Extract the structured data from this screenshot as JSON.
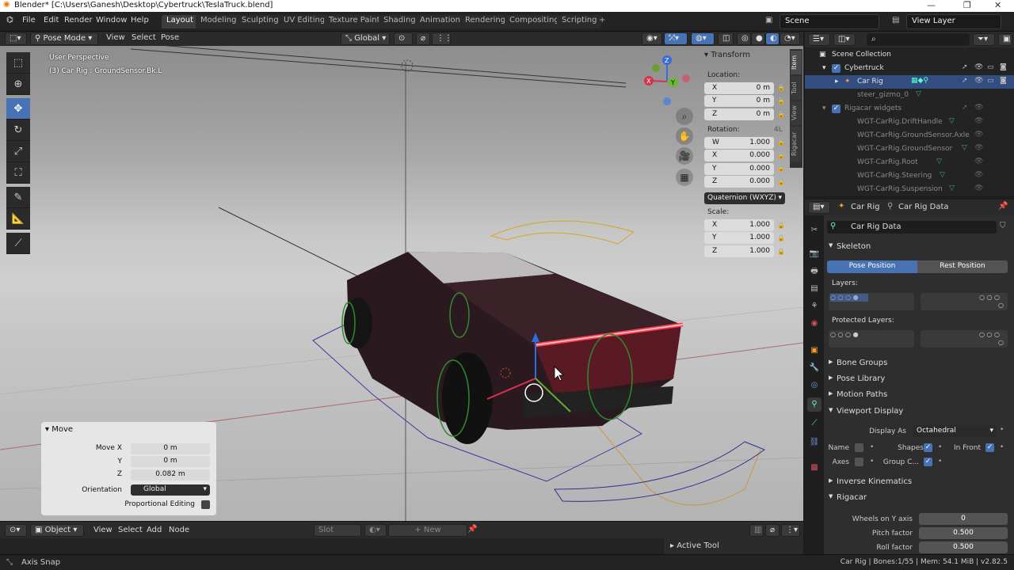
{
  "window": {
    "title": "Blender* [C:\\Users\\Ganesh\\Desktop\\Cybertruck\\TeslaTruck.blend]"
  },
  "menus": [
    "File",
    "Edit",
    "Render",
    "Window",
    "Help"
  ],
  "workspaces": [
    "Layout",
    "Modeling",
    "Sculpting",
    "UV Editing",
    "Texture Paint",
    "Shading",
    "Animation",
    "Rendering",
    "Compositing",
    "Scripting"
  ],
  "scene": {
    "label": "Scene"
  },
  "viewlayer": {
    "label": "View Layer"
  },
  "viewport": {
    "mode": "Pose Mode",
    "menus": [
      "View",
      "Select",
      "Pose"
    ],
    "orientation": "Global",
    "info_line1": "User Perspective",
    "info_line2": "(3) Car Rig : GroundSensor.Bk.L",
    "gizmo": {
      "z": "Z",
      "x": "X",
      "y": "Y"
    }
  },
  "transform": {
    "title": "Transform",
    "location_label": "Location:",
    "location": [
      {
        "k": "X",
        "v": "0 m"
      },
      {
        "k": "Y",
        "v": "0 m"
      },
      {
        "k": "Z",
        "v": "0 m"
      }
    ],
    "rotation_label": "Rotation:",
    "rotation_mode_short": "4L",
    "rotation": [
      {
        "k": "W",
        "v": "1.000"
      },
      {
        "k": "X",
        "v": "0.000"
      },
      {
        "k": "Y",
        "v": "0.000"
      },
      {
        "k": "Z",
        "v": "0.000"
      }
    ],
    "rotation_mode": "Quaternion (WXYZ)",
    "scale_label": "Scale:",
    "scale": [
      {
        "k": "X",
        "v": "1.000"
      },
      {
        "k": "Y",
        "v": "1.000"
      },
      {
        "k": "Z",
        "v": "1.000"
      }
    ]
  },
  "sidetabs": [
    "Item",
    "Tool",
    "View",
    "Rigacar"
  ],
  "move_panel": {
    "title": "Move",
    "move_x_label": "Move X",
    "move_x": "0 m",
    "y_label": "Y",
    "y": "0 m",
    "z_label": "Z",
    "z": "0.082 m",
    "orientation_label": "Orientation",
    "orientation": "Global",
    "proportional_label": "Proportional Editing"
  },
  "bottom_header": {
    "mode": "Object",
    "menus": [
      "View",
      "Select",
      "Add",
      "Node"
    ],
    "slot": "Slot",
    "new": "New"
  },
  "timeline": {
    "active_tool": "Active Tool"
  },
  "status": {
    "left": "Axis Snap",
    "right": "Car Rig | Bones:1/55 | Mem: 54.1 MiB | v2.82.5"
  },
  "outliner": {
    "rows": [
      {
        "name": "Scene Collection",
        "indent": 0,
        "state": "normal"
      },
      {
        "name": "Cybertruck",
        "indent": 1,
        "state": "normal"
      },
      {
        "name": "Car Rig",
        "indent": 2,
        "state": "selected"
      },
      {
        "name": "steer_gizmo_0",
        "indent": 2,
        "state": "dim"
      },
      {
        "name": "Rigacar widgets",
        "indent": 1,
        "state": "dim"
      },
      {
        "name": "WGT-CarRig.DriftHandle",
        "indent": 2,
        "state": "dim"
      },
      {
        "name": "WGT-CarRig.GroundSensor.Axle",
        "indent": 2,
        "state": "dim"
      },
      {
        "name": "WGT-CarRig.GroundSensor",
        "indent": 2,
        "state": "dim"
      },
      {
        "name": "WGT-CarRig.Root",
        "indent": 2,
        "state": "dim"
      },
      {
        "name": "WGT-CarRig.Steering",
        "indent": 2,
        "state": "dim"
      },
      {
        "name": "WGT-CarRig.Suspension",
        "indent": 2,
        "state": "dim"
      }
    ]
  },
  "properties": {
    "breadcrumb_object": "Car Rig",
    "breadcrumb_data": "Car Rig Data",
    "data_name": "Car Rig Data",
    "skeleton": "Skeleton",
    "pose_position": "Pose Position",
    "rest_position": "Rest Position",
    "layers": "Layers:",
    "protected_layers": "Protected Layers:",
    "sections_closed": [
      "Bone Groups",
      "Pose Library",
      "Motion Paths"
    ],
    "viewport_display": "Viewport Display",
    "display_as_label": "Display As",
    "display_as": "Octahedral",
    "name_label": "Name",
    "shapes_label": "Shapes",
    "in_front_label": "In Front",
    "axes_label": "Axes",
    "group_colors_label": "Group C...",
    "inverse_kinematics": "Inverse Kinematics",
    "rigacar": "Rigacar",
    "wheels_label": "Wheels on Y axis",
    "wheels": "0",
    "pitch_label": "Pitch factor",
    "pitch": "0.500",
    "roll_label": "Roll factor",
    "roll": "0.500"
  },
  "colors": {
    "accent": "#4772b3",
    "selected_row": "#334d80",
    "tail_light": "#ff3b4a"
  }
}
